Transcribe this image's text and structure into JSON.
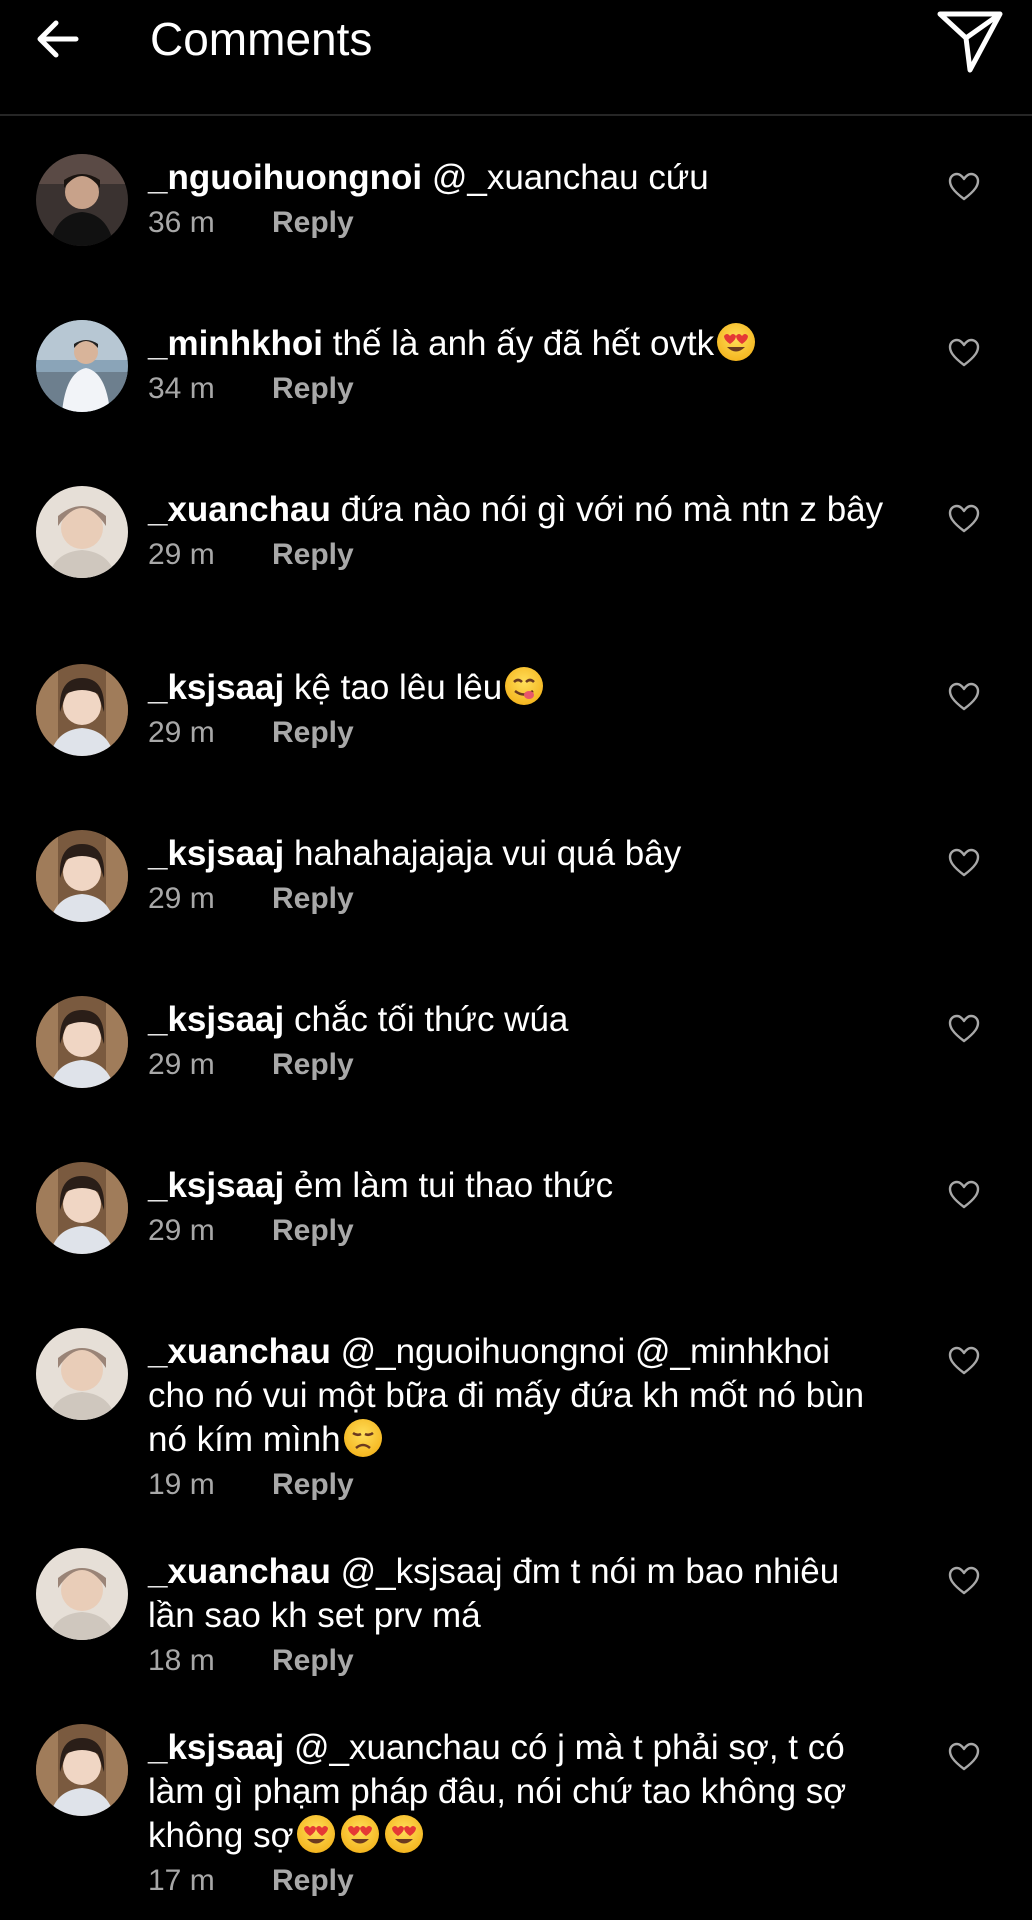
{
  "header": {
    "title": "Comments"
  },
  "icons": {
    "back": "arrow-left-icon",
    "send": "paper-plane-icon",
    "like": "heart-outline-icon"
  },
  "colors": {
    "background": "#000000",
    "text": "#ffffff",
    "muted": "#a8a8a8",
    "divider": "#262626"
  },
  "comments": [
    {
      "username": "_nguoihuongnoi",
      "text": "@_xuanchau cứu",
      "time": "36 m",
      "reply": "Reply",
      "avatar": "avatar-1"
    },
    {
      "username": "_minhkhoi",
      "text": "thế là anh ấy đã hết ovtk",
      "emojis": [
        "heart-eyes"
      ],
      "time": "34 m",
      "reply": "Reply",
      "avatar": "avatar-2"
    },
    {
      "username": "_xuanchau",
      "text": "đứa nào nói gì với nó mà ntn z bây",
      "time": "29 m",
      "reply": "Reply",
      "avatar": "avatar-3"
    },
    {
      "username": "_ksjsaaj",
      "text": "kệ tao lêu lêu",
      "emojis": [
        "yum"
      ],
      "time": "29 m",
      "reply": "Reply",
      "avatar": "avatar-4"
    },
    {
      "username": "_ksjsaaj",
      "text": "hahahajajaja vui quá bây",
      "time": "29 m",
      "reply": "Reply",
      "avatar": "avatar-4"
    },
    {
      "username": "_ksjsaaj",
      "text": "chắc tối thức wúa",
      "time": "29 m",
      "reply": "Reply",
      "avatar": "avatar-4"
    },
    {
      "username": "_ksjsaaj",
      "text": "ẻm làm tui thao thức",
      "time": "29 m",
      "reply": "Reply",
      "avatar": "avatar-4"
    },
    {
      "username": "_xuanchau",
      "text": "@_nguoihuongnoi @_minhkhoi cho nó vui một bữa đi mấy đứa kh mốt nó bùn nó kím mình",
      "emojis": [
        "disappointed"
      ],
      "time": "19 m",
      "reply": "Reply",
      "avatar": "avatar-3"
    },
    {
      "username": "_xuanchau",
      "text": "@_ksjsaaj đm t nói m bao nhiêu lần sao kh set prv má",
      "time": "18 m",
      "reply": "Reply",
      "avatar": "avatar-3"
    },
    {
      "username": "_ksjsaaj",
      "text": "@_xuanchau có j mà t phải sợ, t có làm gì phạm pháp đâu, nói chứ tao không sợ không sợ",
      "emojis": [
        "heart-eyes",
        "heart-eyes",
        "heart-eyes"
      ],
      "time": "17 m",
      "reply": "Reply",
      "avatar": "avatar-4"
    }
  ]
}
